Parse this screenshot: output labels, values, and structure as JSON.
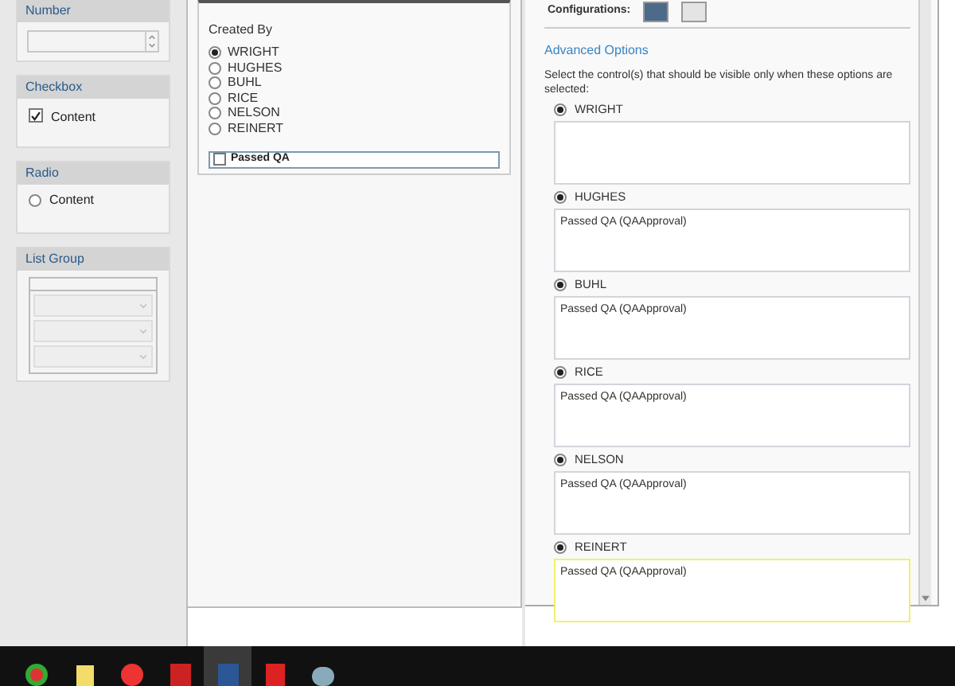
{
  "left_panels": [
    {
      "kind": "number",
      "title": "Number"
    },
    {
      "kind": "checkbox",
      "title": "Checkbox",
      "option": {
        "label": "Content",
        "checked": true
      }
    },
    {
      "kind": "radio",
      "title": "Radio",
      "option": {
        "label": "Content",
        "selected": false
      }
    },
    {
      "kind": "list",
      "title": "List Group"
    }
  ],
  "preview": {
    "created_by_label": "Created By",
    "options": [
      {
        "label": "WRIGHT",
        "selected": true
      },
      {
        "label": "HUGHES",
        "selected": false
      },
      {
        "label": "BUHL",
        "selected": false
      },
      {
        "label": "RICE",
        "selected": false
      },
      {
        "label": "NELSON",
        "selected": false
      },
      {
        "label": "REINERT",
        "selected": false
      }
    ],
    "passed_qa": {
      "label": "Passed QA",
      "checked": false
    }
  },
  "settings": {
    "configurations_label": "Configurations:",
    "advanced_title": "Advanced Options",
    "description": "Select the control(s) that should be visible only when these options are selected:",
    "options": [
      {
        "label": "WRIGHT",
        "selected": true,
        "focused": false
      },
      {
        "label": "HUGHES",
        "selected": true,
        "controls": [
          "Passed QA (QAApproval)"
        ],
        "focused": false
      },
      {
        "label": "BUHL",
        "selected": true,
        "controls": [
          "Passed QA (QAApproval)"
        ],
        "focused": false
      },
      {
        "label": "RICE",
        "selected": true,
        "controls": [
          "Passed QA (QAApproval)"
        ],
        "focused": false
      },
      {
        "label": "NELSON",
        "selected": true,
        "controls": [
          "Passed QA (QAApproval)"
        ],
        "focused": false
      },
      {
        "label": "REINERT",
        "selected": true,
        "controls": [
          "Passed QA (QAApproval)"
        ],
        "focused": true
      }
    ]
  },
  "taskbar": [
    {
      "kind": "browser",
      "active": false
    },
    {
      "kind": "notes",
      "active": false
    },
    {
      "kind": "dots",
      "active": false
    },
    {
      "kind": "red",
      "active": false
    },
    {
      "kind": "word",
      "active": true
    },
    {
      "kind": "red2",
      "active": false
    },
    {
      "kind": "paint",
      "active": false
    }
  ]
}
